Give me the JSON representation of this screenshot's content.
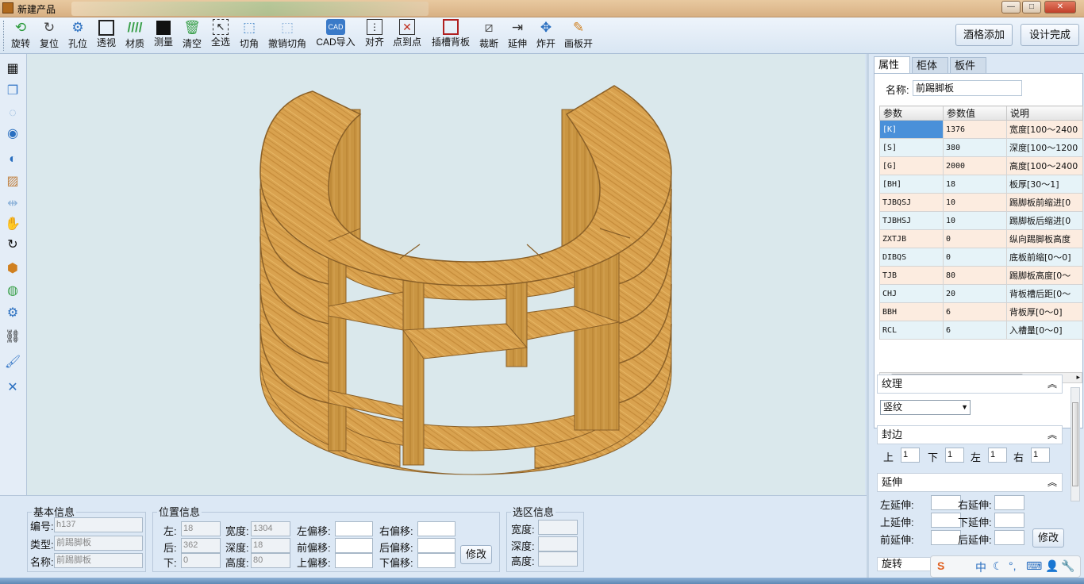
{
  "window": {
    "title": "新建产品",
    "controls": {
      "minimize": "—",
      "maximize": "□",
      "close": "✕"
    }
  },
  "toolbar": {
    "items": [
      {
        "label": "旋转",
        "icon": "rotate-icon"
      },
      {
        "label": "复位",
        "icon": "reset-icon"
      },
      {
        "label": "孔位",
        "icon": "hole-position-icon"
      },
      {
        "label": "透视",
        "icon": "perspective-icon"
      },
      {
        "label": "材质",
        "icon": "material-icon"
      },
      {
        "label": "测量",
        "icon": "measure-icon"
      },
      {
        "label": "清空",
        "icon": "trash-icon"
      },
      {
        "label": "全选",
        "icon": "select-all-icon"
      },
      {
        "label": "切角",
        "icon": "chamfer-icon"
      },
      {
        "label": "撤销切角",
        "icon": "undo-chamfer-icon"
      },
      {
        "label": "CAD导入",
        "icon": "cad-import-icon"
      },
      {
        "label": "对齐",
        "icon": "align-icon"
      },
      {
        "label": "点到点",
        "icon": "point-to-point-icon"
      },
      {
        "label": "插槽背板",
        "icon": "slot-backboard-icon"
      },
      {
        "label": "裁断",
        "icon": "cut-icon"
      },
      {
        "label": "延伸",
        "icon": "extend-icon"
      },
      {
        "label": "炸开",
        "icon": "explode-icon"
      },
      {
        "label": "画板开",
        "icon": "draw-board-icon"
      }
    ],
    "wine_rack_add": "酒格添加",
    "design_complete": "设计完成"
  },
  "left_tools": [
    "calculator-icon",
    "copy-board-icon",
    "hide-icon",
    "eye-icon",
    "contrast-icon",
    "texture-icon",
    "mirror-icon",
    "hand-pan-icon",
    "refresh-icon",
    "component-icon",
    "globe-icon",
    "settings-icon",
    "link-add-icon",
    "brush-icon",
    "wrench-icon"
  ],
  "basic_info": {
    "title": "基本信息",
    "id_label": "编号:",
    "id_value": "h137",
    "type_label": "类型:",
    "type_value": "前踢脚板",
    "name_label": "名称:",
    "name_value": "前踢脚板"
  },
  "position_info": {
    "title": "位置信息",
    "left_label": "左:",
    "left_value": "18",
    "back_label": "后:",
    "back_value": "362",
    "down_label": "下:",
    "down_value": "0",
    "width_label": "宽度:",
    "width_value": "1304",
    "depth_label": "深度:",
    "depth_value": "18",
    "height_label": "高度:",
    "height_value": "80",
    "left_offset": "左偏移:",
    "right_offset": "右偏移:",
    "front_offset": "前偏移:",
    "back_offset": "后偏移:",
    "up_offset": "上偏移:",
    "down_offset": "下偏移:",
    "modify": "修改"
  },
  "selection_info": {
    "title": "选区信息",
    "width_label": "宽度:",
    "depth_label": "深度:",
    "height_label": "高度:"
  },
  "right_panel": {
    "tabs": [
      "属性",
      "柜体",
      "板件"
    ],
    "name_label": "名称:",
    "name_value": "前踢脚板",
    "columns": [
      "参数",
      "参数值",
      "说明"
    ],
    "rows": [
      {
        "key": "[K]",
        "value": "1376",
        "desc": "宽度[100～2400"
      },
      {
        "key": "[S]",
        "value": "380",
        "desc": "深度[100～1200"
      },
      {
        "key": "[G]",
        "value": "2000",
        "desc": "高度[100～2400"
      },
      {
        "key": "[BH]",
        "value": "18",
        "desc": "板厚[30～1]"
      },
      {
        "key": "TJBQSJ",
        "value": "10",
        "desc": "踢脚板前缩进[0"
      },
      {
        "key": "TJBHSJ",
        "value": "10",
        "desc": "踢脚板后缩进[0"
      },
      {
        "key": "ZXTJB",
        "value": "0",
        "desc": "纵向踢脚板高度"
      },
      {
        "key": "DIBQS",
        "value": "0",
        "desc": "底板前缩[0～0]"
      },
      {
        "key": "TJB",
        "value": "80",
        "desc": "踢脚板高度[0～"
      },
      {
        "key": "CHJ",
        "value": "20",
        "desc": "背板槽后距[0～"
      },
      {
        "key": "BBH",
        "value": "6",
        "desc": "背板厚[0～0]"
      },
      {
        "key": "RCL",
        "value": "6",
        "desc": "入槽量[0～0]"
      }
    ],
    "texture": {
      "title": "纹理",
      "value": "竖纹"
    },
    "edge_banding": {
      "title": "封边",
      "top_label": "上",
      "top_value": "1",
      "bottom_label": "下",
      "bottom_value": "1",
      "left_label": "左",
      "left_value": "1",
      "right_label": "右",
      "right_value": "1"
    },
    "extend": {
      "title": "延伸",
      "left": "左延伸:",
      "right": "右延伸:",
      "up": "上延伸:",
      "down": "下延伸:",
      "front": "前延伸:",
      "back": "后延伸:",
      "modify": "修改"
    },
    "rotate_partial": "旋转"
  },
  "ime": {
    "lang": "中"
  },
  "colors": {
    "wood": "#d9a24f",
    "wood_dark": "#b98232",
    "viewport": "#dae8ec"
  }
}
